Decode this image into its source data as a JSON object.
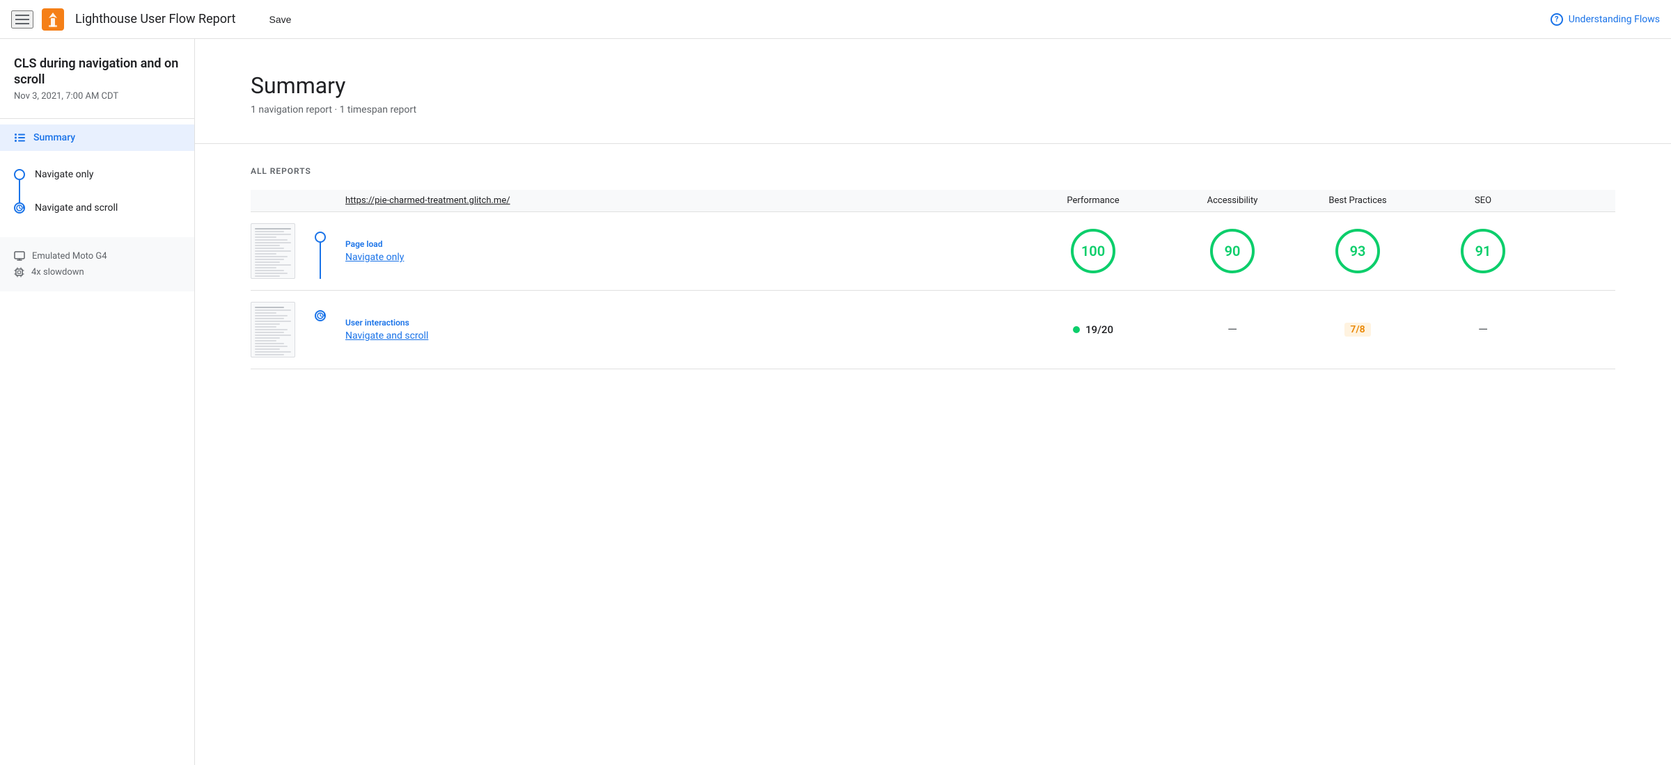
{
  "header": {
    "title": "Lighthouse User Flow Report",
    "save_label": "Save",
    "understanding_flows_label": "Understanding Flows"
  },
  "sidebar": {
    "project_title": "CLS during navigation and on scroll",
    "date": "Nov 3, 2021, 7:00 AM CDT",
    "summary_label": "Summary",
    "nav_items": [
      {
        "label": "Navigate only",
        "type": "circle"
      },
      {
        "label": "Navigate and scroll",
        "type": "clock"
      }
    ],
    "device_items": [
      {
        "label": "Emulated Moto G4",
        "icon": "monitor"
      },
      {
        "label": "4x slowdown",
        "icon": "cpu"
      }
    ]
  },
  "main": {
    "summary": {
      "heading": "Summary",
      "subtext": "1 navigation report · 1 timespan report"
    },
    "reports": {
      "section_heading": "ALL REPORTS",
      "url": "https://pie-charmed-treatment.glitch.me/",
      "columns": [
        "Performance",
        "Accessibility",
        "Best Practices",
        "SEO"
      ],
      "rows": [
        {
          "type": "Page load",
          "name": "Navigate only",
          "timeline_icon": "circle",
          "scores": [
            {
              "value": "100",
              "style": "green"
            },
            {
              "value": "90",
              "style": "green"
            },
            {
              "value": "93",
              "style": "green"
            },
            {
              "value": "91",
              "style": "green"
            }
          ]
        },
        {
          "type": "User interactions",
          "name": "Navigate and scroll",
          "timeline_icon": "clock",
          "scores": [
            {
              "value": "19/20",
              "style": "timespan-green"
            },
            {
              "value": "—",
              "style": "dash"
            },
            {
              "value": "7/8",
              "style": "timespan-orange"
            },
            {
              "value": "—",
              "style": "dash"
            }
          ]
        }
      ]
    }
  },
  "colors": {
    "blue": "#1a73e8",
    "green": "#0cce6b",
    "orange": "#ffa400",
    "orange_text": "#ea8600",
    "gray": "#5f6368",
    "light_blue_bg": "#e8f0fe"
  }
}
